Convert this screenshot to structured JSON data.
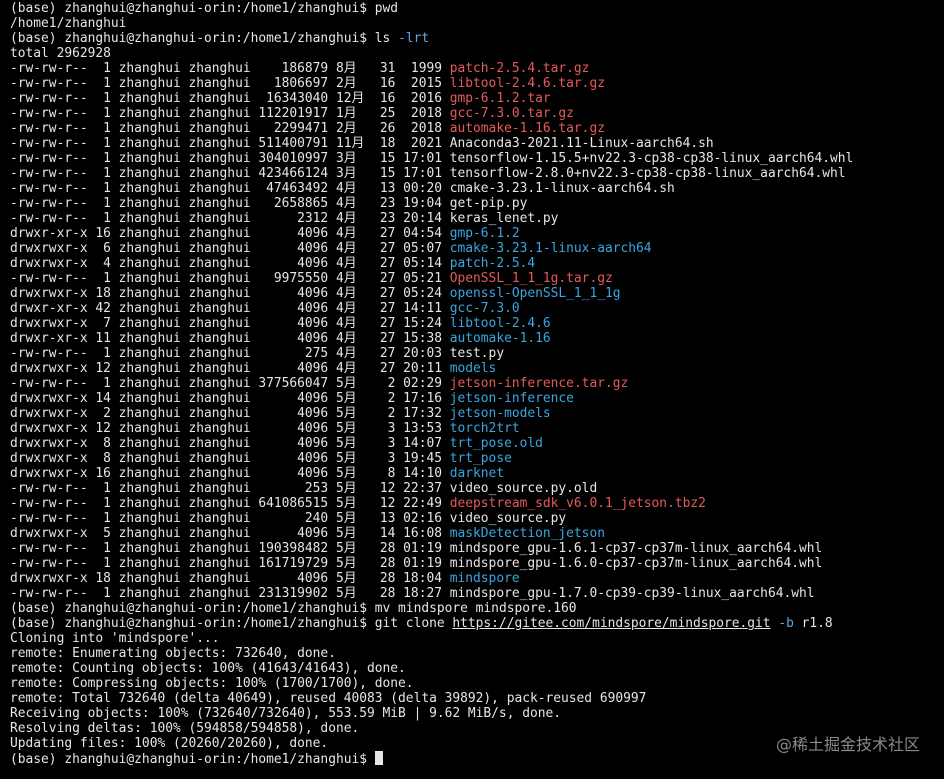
{
  "prompt": "(base) zhanghui@zhanghui-orin:/home1/zhanghui$ ",
  "watermark": "@稀土掘金技术社区",
  "colors": {
    "background": "#000000",
    "text": "#e6e6e6",
    "archive": "#e45a5a",
    "directory": "#3aa6e0",
    "flag": "#5fa8e6"
  },
  "lines": [
    {
      "type": "cmd",
      "cmd": "pwd"
    },
    {
      "type": "text",
      "text": "/home1/zhanghui"
    },
    {
      "type": "cmd",
      "cmd": "ls ",
      "flag": "-lrt"
    },
    {
      "type": "text",
      "text": "total 2962928"
    },
    {
      "type": "ls",
      "meta": "-rw-rw-r--  1 zhanghui zhanghui    186879 8月   31  1999 ",
      "name": "patch-2.5.4.tar.gz",
      "kind": "red"
    },
    {
      "type": "ls",
      "meta": "-rw-rw-r--  1 zhanghui zhanghui   1806697 2月   16  2015 ",
      "name": "libtool-2.4.6.tar.gz",
      "kind": "red"
    },
    {
      "type": "ls",
      "meta": "-rw-rw-r--  1 zhanghui zhanghui  16343040 12月  16  2016 ",
      "name": "gmp-6.1.2.tar",
      "kind": "red"
    },
    {
      "type": "ls",
      "meta": "-rw-rw-r--  1 zhanghui zhanghui 112201917 1月   25  2018 ",
      "name": "gcc-7.3.0.tar.gz",
      "kind": "red"
    },
    {
      "type": "ls",
      "meta": "-rw-rw-r--  1 zhanghui zhanghui   2299471 2月   26  2018 ",
      "name": "automake-1.16.tar.gz",
      "kind": "red"
    },
    {
      "type": "ls",
      "meta": "-rw-rw-r--  1 zhanghui zhanghui 511400791 11月  18  2021 ",
      "name": "Anaconda3-2021.11-Linux-aarch64.sh",
      "kind": "plain"
    },
    {
      "type": "ls",
      "meta": "-rw-rw-r--  1 zhanghui zhanghui 304010997 3月   15 17:01 ",
      "name": "tensorflow-1.15.5+nv22.3-cp38-cp38-linux_aarch64.whl",
      "kind": "plain"
    },
    {
      "type": "ls",
      "meta": "-rw-rw-r--  1 zhanghui zhanghui 423466124 3月   15 17:01 ",
      "name": "tensorflow-2.8.0+nv22.3-cp38-cp38-linux_aarch64.whl",
      "kind": "plain"
    },
    {
      "type": "ls",
      "meta": "-rw-rw-r--  1 zhanghui zhanghui  47463492 4月   13 00:20 ",
      "name": "cmake-3.23.1-linux-aarch64.sh",
      "kind": "plain"
    },
    {
      "type": "ls",
      "meta": "-rw-rw-r--  1 zhanghui zhanghui   2658865 4月   23 19:04 ",
      "name": "get-pip.py",
      "kind": "plain"
    },
    {
      "type": "ls",
      "meta": "-rw-rw-r--  1 zhanghui zhanghui      2312 4月   23 20:14 ",
      "name": "keras_lenet.py",
      "kind": "plain"
    },
    {
      "type": "ls",
      "meta": "drwxr-xr-x 16 zhanghui zhanghui      4096 4月   27 04:54 ",
      "name": "gmp-6.1.2",
      "kind": "blue"
    },
    {
      "type": "ls",
      "meta": "drwxrwxr-x  6 zhanghui zhanghui      4096 4月   27 05:07 ",
      "name": "cmake-3.23.1-linux-aarch64",
      "kind": "blue"
    },
    {
      "type": "ls",
      "meta": "drwxrwxr-x  4 zhanghui zhanghui      4096 4月   27 05:14 ",
      "name": "patch-2.5.4",
      "kind": "blue"
    },
    {
      "type": "ls",
      "meta": "-rw-rw-r--  1 zhanghui zhanghui   9975550 4月   27 05:21 ",
      "name": "OpenSSL_1_1_1g.tar.gz",
      "kind": "red"
    },
    {
      "type": "ls",
      "meta": "drwxrwxr-x 18 zhanghui zhanghui      4096 4月   27 05:24 ",
      "name": "openssl-OpenSSL_1_1_1g",
      "kind": "blue"
    },
    {
      "type": "ls",
      "meta": "drwxr-xr-x 42 zhanghui zhanghui      4096 4月   27 14:11 ",
      "name": "gcc-7.3.0",
      "kind": "blue"
    },
    {
      "type": "ls",
      "meta": "drwxrwxr-x  7 zhanghui zhanghui      4096 4月   27 15:24 ",
      "name": "libtool-2.4.6",
      "kind": "blue"
    },
    {
      "type": "ls",
      "meta": "drwxr-xr-x 11 zhanghui zhanghui      4096 4月   27 15:38 ",
      "name": "automake-1.16",
      "kind": "blue"
    },
    {
      "type": "ls",
      "meta": "-rw-rw-r--  1 zhanghui zhanghui       275 4月   27 20:03 ",
      "name": "test.py",
      "kind": "plain"
    },
    {
      "type": "ls",
      "meta": "drwxrwxr-x 12 zhanghui zhanghui      4096 4月   27 20:11 ",
      "name": "models",
      "kind": "blue"
    },
    {
      "type": "ls",
      "meta": "-rw-rw-r--  1 zhanghui zhanghui 377566047 5月    2 02:29 ",
      "name": "jetson-inference.tar.gz",
      "kind": "red"
    },
    {
      "type": "ls",
      "meta": "drwxrwxr-x 14 zhanghui zhanghui      4096 5月    2 17:16 ",
      "name": "jetson-inference",
      "kind": "blue"
    },
    {
      "type": "ls",
      "meta": "drwxrwxr-x  2 zhanghui zhanghui      4096 5月    2 17:32 ",
      "name": "jetson-models",
      "kind": "blue"
    },
    {
      "type": "ls",
      "meta": "drwxrwxr-x 12 zhanghui zhanghui      4096 5月    3 13:53 ",
      "name": "torch2trt",
      "kind": "blue"
    },
    {
      "type": "ls",
      "meta": "drwxrwxr-x  8 zhanghui zhanghui      4096 5月    3 14:07 ",
      "name": "trt_pose.old",
      "kind": "blue"
    },
    {
      "type": "ls",
      "meta": "drwxrwxr-x  8 zhanghui zhanghui      4096 5月    3 19:45 ",
      "name": "trt_pose",
      "kind": "blue"
    },
    {
      "type": "ls",
      "meta": "drwxrwxr-x 16 zhanghui zhanghui      4096 5月    8 14:10 ",
      "name": "darknet",
      "kind": "blue"
    },
    {
      "type": "ls",
      "meta": "-rw-rw-r--  1 zhanghui zhanghui       253 5月   12 22:37 ",
      "name": "video_source.py.old",
      "kind": "plain"
    },
    {
      "type": "ls",
      "meta": "-rw-rw-r--  1 zhanghui zhanghui 641086515 5月   12 22:49 ",
      "name": "deepstream_sdk_v6.0.1_jetson.tbz2",
      "kind": "red"
    },
    {
      "type": "ls",
      "meta": "-rw-rw-r--  1 zhanghui zhanghui       240 5月   13 02:16 ",
      "name": "video_source.py",
      "kind": "plain"
    },
    {
      "type": "ls",
      "meta": "drwxrwxr-x  5 zhanghui zhanghui      4096 5月   14 16:08 ",
      "name": "maskDetection_jetson",
      "kind": "blue"
    },
    {
      "type": "ls",
      "meta": "-rw-rw-r--  1 zhanghui zhanghui 190398482 5月   28 01:19 ",
      "name": "mindspore_gpu-1.6.1-cp37-cp37m-linux_aarch64.whl",
      "kind": "plain"
    },
    {
      "type": "ls",
      "meta": "-rw-rw-r--  1 zhanghui zhanghui 161719729 5月   28 01:19 ",
      "name": "mindspore_gpu-1.6.0-cp37-cp37m-linux_aarch64.whl",
      "kind": "plain"
    },
    {
      "type": "ls",
      "meta": "drwxrwxr-x 18 zhanghui zhanghui      4096 5月   28 18:04 ",
      "name": "mindspore",
      "kind": "blue"
    },
    {
      "type": "ls",
      "meta": "-rw-rw-r--  1 zhanghui zhanghui 231319902 5月   28 18:27 ",
      "name": "mindspore_gpu-1.7.0-cp39-cp39-linux_aarch64.whl",
      "kind": "plain"
    },
    {
      "type": "cmd",
      "cmd": "mv mindspore mindspore.160"
    },
    {
      "type": "git",
      "cmd": "git clone ",
      "url": "https://gitee.com/mindspore/mindspore.git",
      "flag": "-b",
      "tail": " r1.8"
    },
    {
      "type": "text",
      "text": "Cloning into 'mindspore'..."
    },
    {
      "type": "text",
      "text": "remote: Enumerating objects: 732640, done."
    },
    {
      "type": "text",
      "text": "remote: Counting objects: 100% (41643/41643), done."
    },
    {
      "type": "text",
      "text": "remote: Compressing objects: 100% (1700/1700), done."
    },
    {
      "type": "text",
      "text": "remote: Total 732640 (delta 40649), reused 40083 (delta 39892), pack-reused 690997"
    },
    {
      "type": "text",
      "text": "Receiving objects: 100% (732640/732640), 553.59 MiB | 9.62 MiB/s, done."
    },
    {
      "type": "text",
      "text": "Resolving deltas: 100% (594858/594858), done."
    },
    {
      "type": "text",
      "text": "Updating files: 100% (20260/20260), done."
    },
    {
      "type": "cursor"
    }
  ]
}
